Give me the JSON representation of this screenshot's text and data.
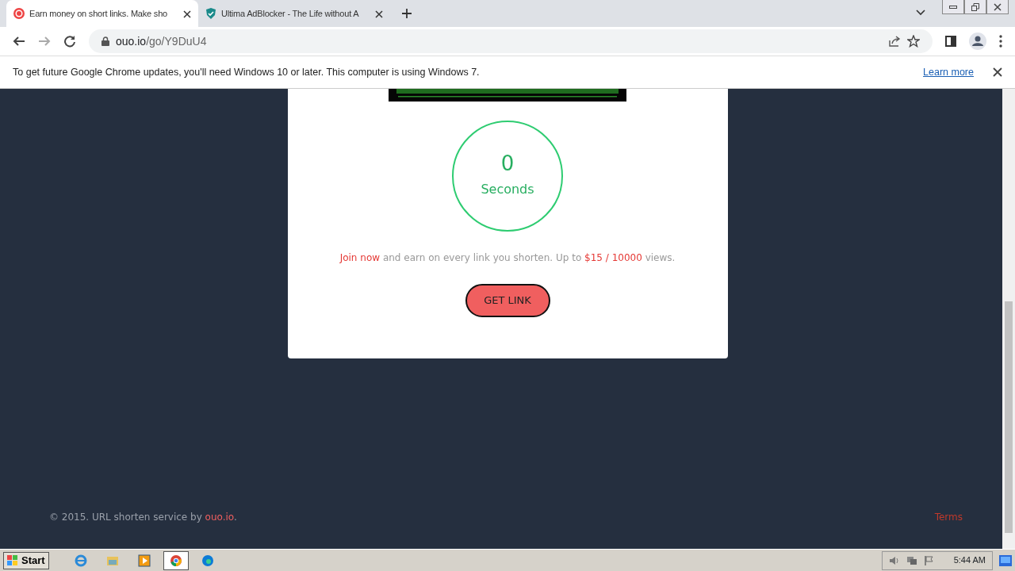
{
  "browser": {
    "tabs": [
      {
        "title": "Earn money on short links. Make sho",
        "selected": true
      },
      {
        "title": "Ultima AdBlocker - The Life without A",
        "selected": false
      }
    ],
    "address": {
      "host": "ouo.io",
      "path": "/go/Y9DuU4"
    },
    "infobar": {
      "message": "To get future Google Chrome updates, you'll need Windows 10 or later. This computer is using Windows 7.",
      "link": "Learn more"
    }
  },
  "page": {
    "countdown": {
      "value": "0",
      "unit": "Seconds"
    },
    "promo": [
      {
        "text": "Join now",
        "kind": "link"
      },
      {
        "text": " and earn on every link you shorten. Up to ",
        "kind": "plain"
      },
      {
        "text": "$15 / 10000",
        "kind": "highlight"
      },
      {
        "text": " views.",
        "kind": "plain"
      }
    ],
    "button": "GET LINK",
    "footer": {
      "text": "© 2015. URL shorten service by ",
      "link": "ouo.io",
      "end": ".",
      "terms": "Terms"
    }
  },
  "taskbar": {
    "start": "Start",
    "apps": [
      {
        "selected": false
      },
      {
        "selected": false
      },
      {
        "selected": false
      },
      {
        "selected": true
      },
      {
        "selected": false
      }
    ],
    "clock": "5:44 AM"
  }
}
